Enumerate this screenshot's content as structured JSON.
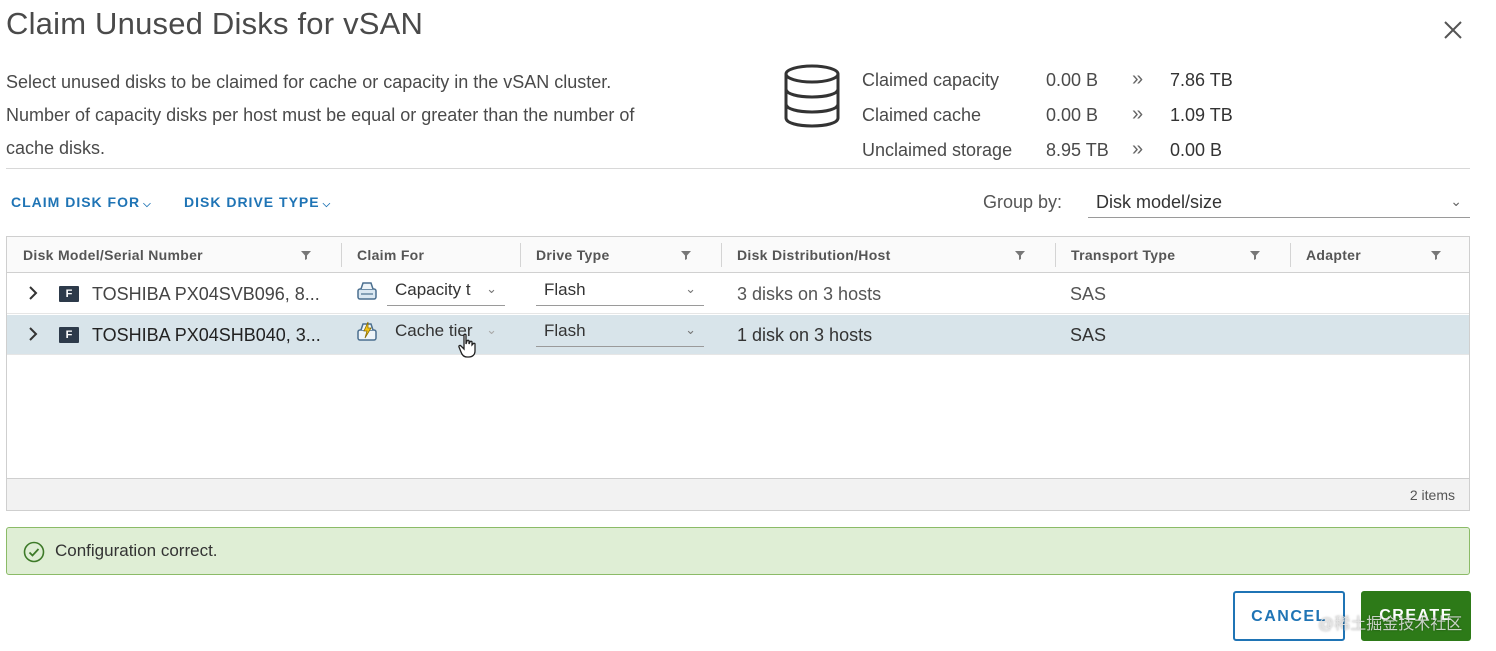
{
  "dialog": {
    "title": "Claim Unused Disks for vSAN",
    "description": "Select unused disks to be claimed for cache or capacity in the vSAN cluster. Number of capacity disks per host must be equal or greater than the number of cache disks.",
    "close_icon": "close-icon"
  },
  "summary": {
    "icon": "database-icon",
    "rows": [
      {
        "label": "Claimed capacity",
        "current": "0.00 B",
        "arrow": "»",
        "new": "7.86 TB"
      },
      {
        "label": "Claimed cache",
        "current": "0.00 B",
        "arrow": "»",
        "new": "1.09 TB"
      },
      {
        "label": "Unclaimed storage",
        "current": "8.95 TB",
        "arrow": "»",
        "new": "0.00 B"
      }
    ]
  },
  "toolbar": {
    "claim_disk_for": "CLAIM DISK FOR",
    "disk_drive_type": "DISK DRIVE TYPE",
    "group_by_label": "Group by:",
    "group_by_value": "Disk model/size"
  },
  "grid": {
    "columns": [
      "Disk Model/Serial Number",
      "Claim For",
      "Drive Type",
      "Disk Distribution/Host",
      "Transport Type",
      "Adapter"
    ],
    "rows": [
      {
        "badge": "F",
        "model": "TOSHIBA PX04SVB096, 8...",
        "claim_for": "Capacity t",
        "drive_type": "Flash",
        "distribution": "3 disks on 3 hosts",
        "transport": "SAS",
        "adapter": "",
        "claim_icon": "capacity-tier-icon"
      },
      {
        "badge": "F",
        "model": "TOSHIBA PX04SHB040, 3...",
        "claim_for": "Cache tier",
        "drive_type": "Flash",
        "distribution": "1 disk on 3 hosts",
        "transport": "SAS",
        "adapter": "",
        "claim_icon": "cache-tier-icon"
      }
    ],
    "footer_count": "2 items"
  },
  "alert": {
    "message": "Configuration correct.",
    "status_color": "#8bbb67"
  },
  "buttons": {
    "cancel": "CANCEL",
    "create": "CREATE"
  },
  "watermark": "@稀土掘金技术社区",
  "colors": {
    "accent": "#1f74b5",
    "primary_button": "#2d7a18",
    "selected_row": "#d8e4ea"
  }
}
